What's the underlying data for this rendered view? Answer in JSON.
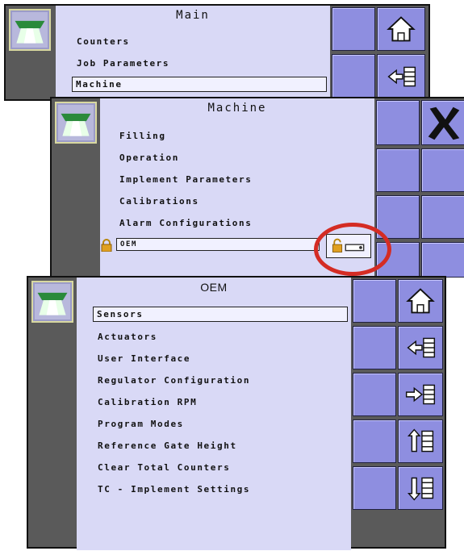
{
  "main": {
    "title": "Main",
    "items": [
      "Counters",
      "Job Parameters",
      "Machine"
    ]
  },
  "machine": {
    "title": "Machine",
    "items": [
      "Filling",
      "Operation",
      "Implement Parameters",
      "Calibrations",
      "Alarm Configurations",
      "OEM"
    ]
  },
  "oem": {
    "title": "OEM",
    "items": [
      "Sensors",
      "Actuators",
      "User Interface",
      "Regulator Configuration",
      "Calibration RPM",
      "Program Modes",
      "Reference Gate Height",
      "Clear Total Counters",
      "TC - Implement Settings"
    ]
  },
  "icons": {
    "logo": "spreader-logo-icon",
    "home": "home-icon",
    "back": "back-to-list-icon",
    "forward": "forward-to-list-icon",
    "page_up": "page-up-icon",
    "page_down": "page-down-icon",
    "close": "close-x-icon",
    "lock": "padlock-icon",
    "unlock_toggle": "unlock-key-icon"
  },
  "colors": {
    "panel": "#d9d9f6",
    "button": "#8e8ee0",
    "frame": "#5a5a5a",
    "highlight_ring": "#d42c24"
  }
}
